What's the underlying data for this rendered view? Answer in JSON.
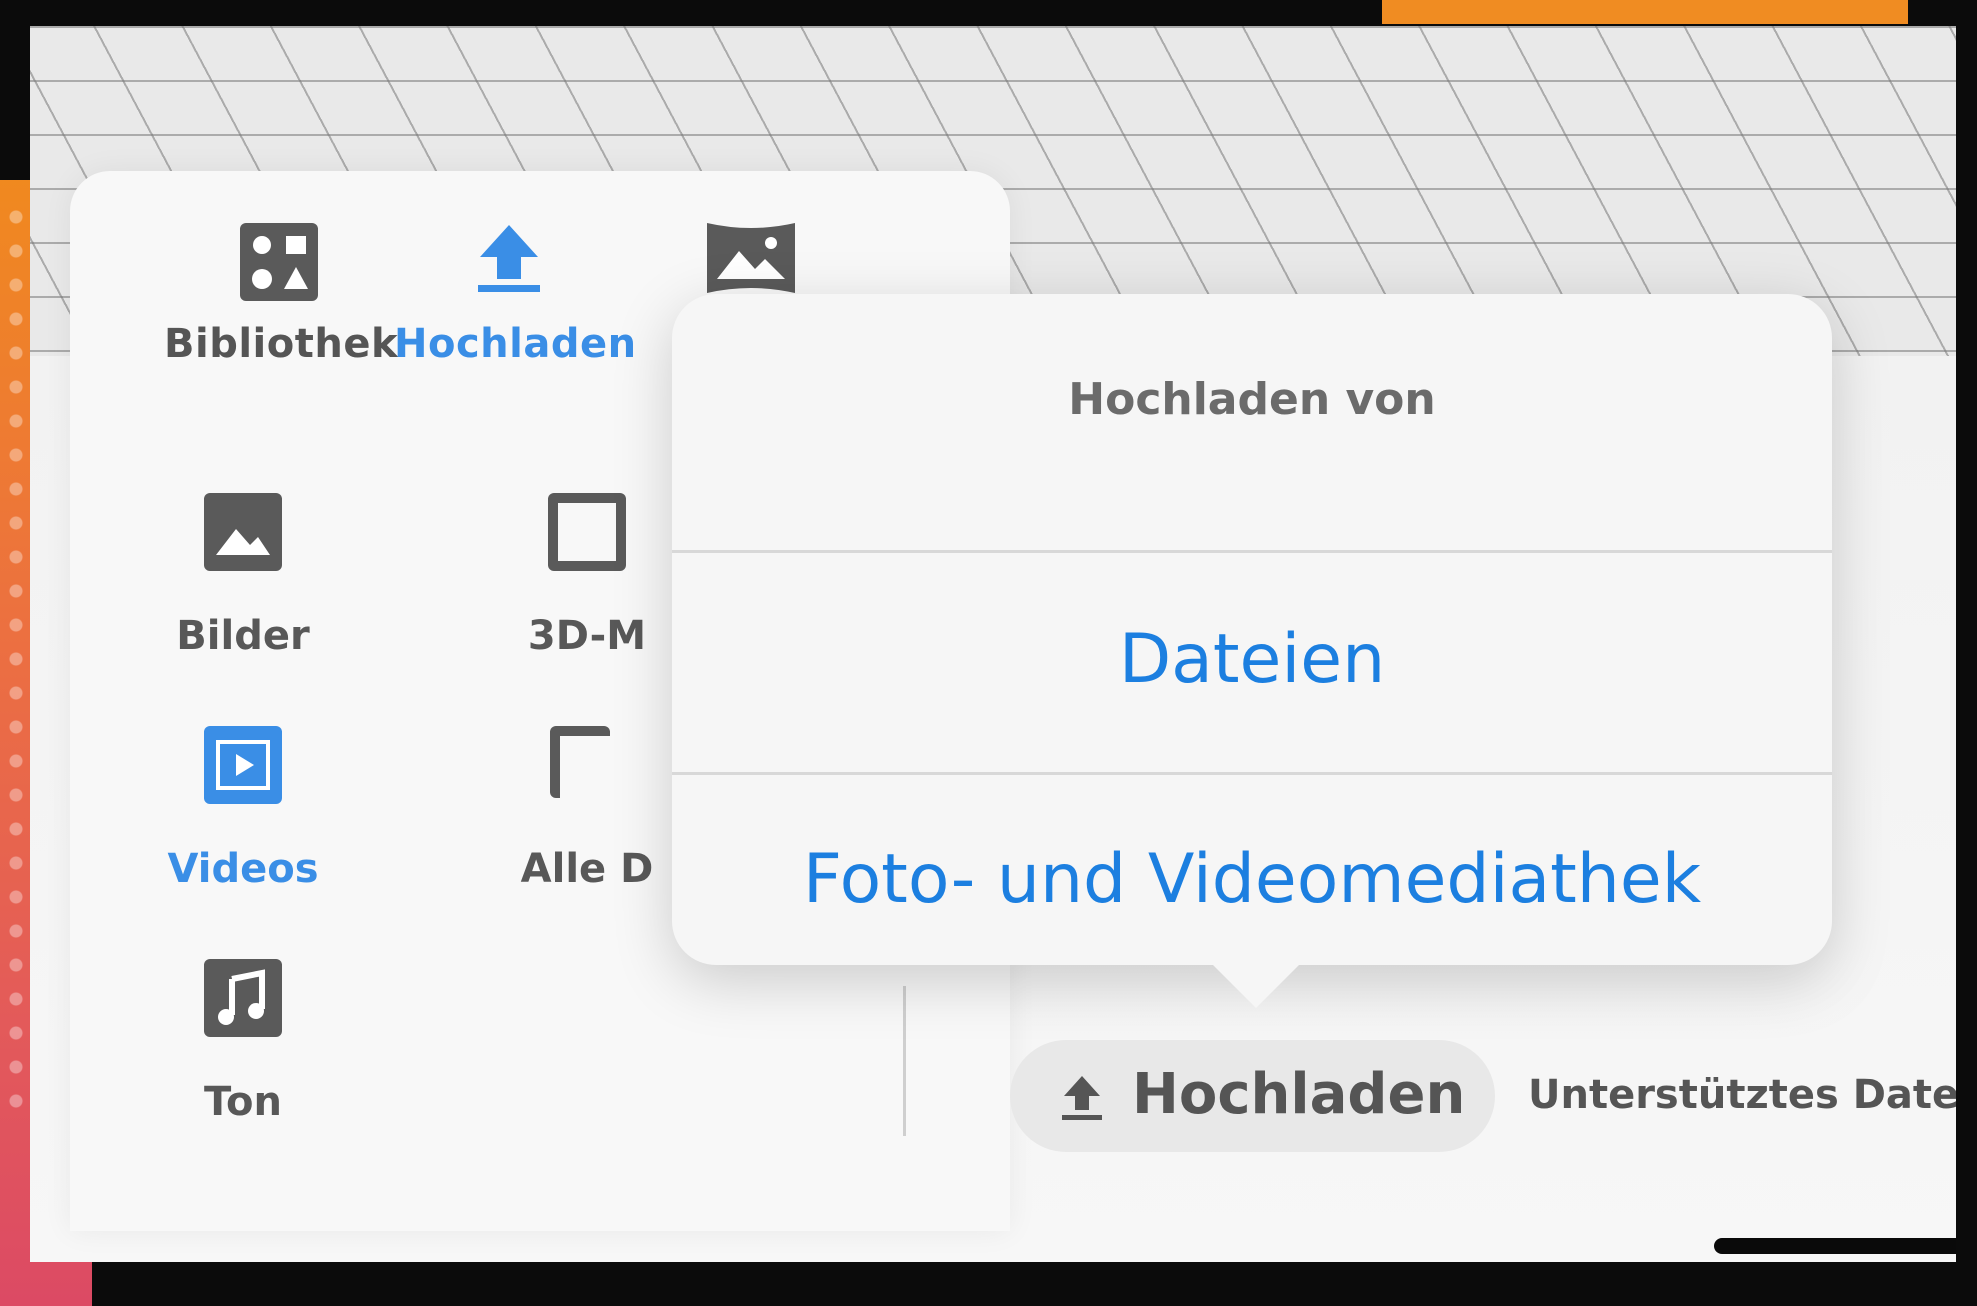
{
  "tabs": [
    {
      "label": "Bibliothek",
      "icon": "library-shapes-icon",
      "active": false
    },
    {
      "label": "Hochladen",
      "icon": "upload-icon",
      "active": true
    },
    {
      "label": "",
      "icon": "panorama-icon",
      "active": false
    }
  ],
  "categories": [
    {
      "label": "Bilder",
      "icon": "image-icon",
      "active": false
    },
    {
      "label": "3D-M",
      "icon": "3d-model-icon",
      "active": false
    },
    {
      "label": "Videos",
      "icon": "video-icon",
      "active": true
    },
    {
      "label": "Alle D",
      "icon": "all-files-icon",
      "active": false
    },
    {
      "label": "Ton",
      "icon": "music-icon",
      "active": false
    }
  ],
  "upload_button": {
    "label": "Hochladen",
    "icon": "upload-arrow-icon"
  },
  "format_note": "Unterstütztes Dateifor",
  "popover": {
    "title": "Hochladen von",
    "options": [
      "Dateien",
      "Foto- und Videomediathek"
    ]
  },
  "colors": {
    "accent": "#3a8ee6",
    "link": "#1c7fe0",
    "icon_gray": "#5a5a5a",
    "backdrop_orange": "#f08c22"
  }
}
